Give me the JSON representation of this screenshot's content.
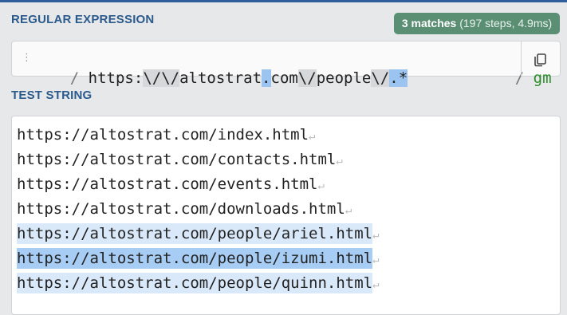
{
  "regex_section": {
    "title": "REGULAR EXPRESSION"
  },
  "match_badge": {
    "count": "3 matches",
    "detail": "(197 steps, 4.9ms)"
  },
  "regex": {
    "open_delim": "/",
    "tokens": [
      {
        "text": "https:",
        "kind": "plain"
      },
      {
        "text": "\\/",
        "kind": "esc"
      },
      {
        "text": "\\/",
        "kind": "esc"
      },
      {
        "text": "altostrat",
        "kind": "plain"
      },
      {
        "text": ".",
        "kind": "hl"
      },
      {
        "text": "com",
        "kind": "plain"
      },
      {
        "text": "\\/",
        "kind": "esc"
      },
      {
        "text": "people",
        "kind": "plain"
      },
      {
        "text": "\\/",
        "kind": "esc"
      },
      {
        "text": ".*",
        "kind": "hl"
      }
    ],
    "close_delim": "/",
    "flags": "gm"
  },
  "test_section": {
    "title": "TEST STRING"
  },
  "test_lines": [
    {
      "text": "https://altostrat.com/index.html",
      "match": false
    },
    {
      "text": "https://altostrat.com/contacts.html",
      "match": false
    },
    {
      "text": "https://altostrat.com/events.html",
      "match": false
    },
    {
      "text": "https://altostrat.com/downloads.html",
      "match": false
    },
    {
      "text": "https://altostrat.com/people/ariel.html",
      "match": true
    },
    {
      "text": "https://altostrat.com/people/izumi.html",
      "match": true
    },
    {
      "text": "https://altostrat.com/people/quinn.html",
      "match": true
    }
  ],
  "newline_symbol": "↵",
  "icons": {
    "drag": "drag-handle-icon",
    "copy": "copy-icon"
  },
  "colors": {
    "accent": "#2b5a8c",
    "badge": "#5b8f74",
    "match": "#d9e9fa",
    "match_alt": "#a8cdf4",
    "flags": "#2a8a2a"
  }
}
